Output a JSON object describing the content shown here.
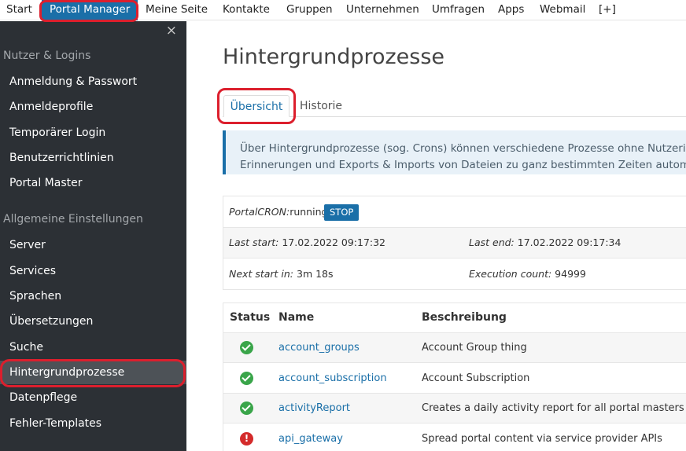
{
  "topnav": {
    "items": [
      "Start",
      "Portal Manager",
      "Meine Seite",
      "Kontakte",
      "Gruppen",
      "Unternehmen",
      "Umfragen",
      "Apps",
      "Webmail",
      "[+]"
    ],
    "active": "Portal Manager"
  },
  "sidebar": {
    "close": "×",
    "section1": "Nutzer & Logins",
    "section1_items": [
      "Anmeldung & Passwort",
      "Anmeldeprofile",
      "Temporärer Login",
      "Benutzerrichtlinien",
      "Portal Master"
    ],
    "section2": "Allgemeine Einstellungen",
    "section2_items": [
      "Server",
      "Services",
      "Sprachen",
      "Übersetzungen",
      "Suche",
      "Hintergrundprozesse",
      "Datenpflege",
      "Fehler-Templates"
    ],
    "active": "Hintergrundprozesse"
  },
  "main": {
    "title": "Hintergrundprozesse",
    "tabs": [
      {
        "label": "Übersicht",
        "active": true
      },
      {
        "label": "Historie",
        "active": false
      }
    ],
    "info_line1": "Über Hintergrundprozesse (sog. Crons) können verschiedene Prozesse ohne Nutzerinte",
    "info_line2": "Erinnerungen und Exports & Imports von Dateien zu ganz bestimmten Zeiten automatisc"
  },
  "cron": {
    "label": "PortalCRON:",
    "state": "running",
    "stop_label": "STOP",
    "last_start_label": "Last start:",
    "last_start": "17.02.2022 09:17:32",
    "last_end_label": "Last end:",
    "last_end": "17.02.2022 09:17:34",
    "next_start_label": "Next start in:",
    "next_start": "3m 18s",
    "exec_count_label": "Execution count:",
    "exec_count": "94999"
  },
  "jobs": {
    "columns": [
      "Status",
      "Name",
      "Beschreibung"
    ],
    "rows": [
      {
        "status": "ok",
        "name": "account_groups",
        "desc": "Account Group thing"
      },
      {
        "status": "ok",
        "name": "account_subscription",
        "desc": "Account Subscription"
      },
      {
        "status": "ok",
        "name": "activityReport",
        "desc": "Creates a daily activity report for all portal masters"
      },
      {
        "status": "error",
        "name": "api_gateway",
        "desc": "Spread portal content via service provider APIs"
      }
    ]
  },
  "colors": {
    "accent": "#1a6fa8",
    "sidebar_bg": "#2c3035",
    "annotation": "#dc1f2d",
    "status_ok": "#3aa54a",
    "status_error": "#d42b2b"
  },
  "icons": {
    "close": "close-icon",
    "status_ok": "check-circle-icon",
    "status_error": "exclamation-circle-icon"
  }
}
